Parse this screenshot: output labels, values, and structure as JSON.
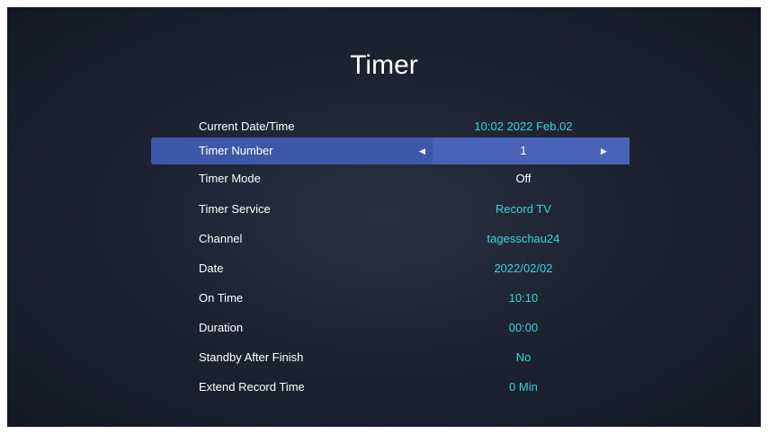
{
  "title": "Timer",
  "rows": [
    {
      "label": "Current Date/Time",
      "value": "10:02 2022 Feb.02"
    },
    {
      "label": "Timer Number",
      "value": "1"
    },
    {
      "label": "Timer Mode",
      "value": "Off"
    },
    {
      "label": "Timer Service",
      "value": "Record TV"
    },
    {
      "label": "Channel",
      "value": "tagesschau24"
    },
    {
      "label": "Date",
      "value": "2022/02/02"
    },
    {
      "label": "On Time",
      "value": "10:10"
    },
    {
      "label": "Duration",
      "value": "00:00"
    },
    {
      "label": "Standby After Finish",
      "value": "No"
    },
    {
      "label": "Extend Record Time",
      "value": "0 Min"
    }
  ],
  "arrows": {
    "left": "◀",
    "right": "▶"
  },
  "colors": {
    "accent_value": "#36d6d6",
    "selected_row": "#3f57a8"
  }
}
